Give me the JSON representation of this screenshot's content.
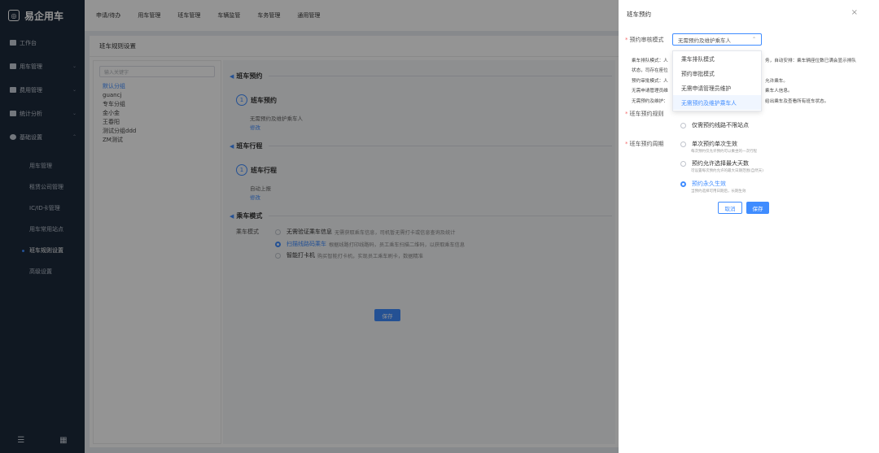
{
  "app": {
    "logo_text": "易企用车"
  },
  "sidebar": {
    "items": [
      {
        "label": "工作台"
      },
      {
        "label": "用车管理"
      },
      {
        "label": "费用管理"
      },
      {
        "label": "统计分析"
      },
      {
        "label": "基础设置"
      }
    ],
    "sub_items": [
      {
        "label": "用车管理"
      },
      {
        "label": "租赁公司管理"
      },
      {
        "label": "IC/ID卡管理"
      },
      {
        "label": "用车常用站点"
      },
      {
        "label": "班车规则设置"
      },
      {
        "label": "高级设置"
      }
    ]
  },
  "topnav": [
    "申请/待办",
    "用车管理",
    "班车管理",
    "车辆监管",
    "车务管理",
    "通用管理"
  ],
  "page": {
    "title": "班车规则设置"
  },
  "tree": {
    "placeholder": "输入关键字",
    "items": [
      "默认分组",
      "guancj",
      "专车分组",
      "金小金",
      "王春阳",
      "测试分组ddd",
      "ZM测试"
    ]
  },
  "detail": {
    "sec1": "班车预约",
    "step1_num": "1",
    "step1_title": "班车预约",
    "step1_desc": "无需预约及维护乘车人",
    "step1_link": "修改",
    "sec2": "班车行程",
    "step2_num": "1",
    "step2_title": "班车行程",
    "step2_desc": "自动上报",
    "step2_link": "修改",
    "sec3": "乘车模式",
    "mode_label": "乘车模式",
    "modes": [
      {
        "title": "无需验证乘车信息",
        "hint": "无需获取乘车信息，司机暂无需打卡或信息查询及统计"
      },
      {
        "title": "扫描线路码乘车",
        "hint": "根据线路打印线路码，员工乘车扫描二维码，以获取乘车信息"
      },
      {
        "title": "智能打卡机",
        "hint": "购买智能打卡机，实现员工乘车刷卡，数据精准"
      }
    ],
    "save_label": "保存"
  },
  "drawer": {
    "title": "班车预约",
    "close_glyph": "×",
    "review_label": "预约审核模式",
    "review_value": "无需预约及维护乘车人",
    "desc_lines": [
      "乘车排队模式：人",
      "状态，司存在座位",
      "预约审批模式：人",
      "无需申请管理员维",
      "无需预约及维护："
    ],
    "desc_right": [
      "务，自动安排：乘车辆座位数已满会显示排队",
      "允许乘车。",
      "乘车人信息。",
      "给出乘车及查看所有班车状态。"
    ],
    "dropdown": [
      "乘车排队模式",
      "预约审批模式",
      "无需申请管理员维护",
      "无需预约及维护乘车人"
    ],
    "rule_label": "班车预约规则",
    "rule_option": "仅需预约线路不限站点",
    "period_label": "班车预约周期",
    "periods": [
      {
        "title": "单次预约单次生效",
        "sub": "每次预约仅允许预约可以乘坐的一次行程"
      },
      {
        "title": "预约允许选择最大天数",
        "sub": "可设置每次预约允许的最大日期范围(自然天)"
      },
      {
        "title": "预约永久生效",
        "sub": "当预约选择可用日期后，长期生效"
      }
    ],
    "cancel_label": "取消",
    "save_label": "保存"
  }
}
